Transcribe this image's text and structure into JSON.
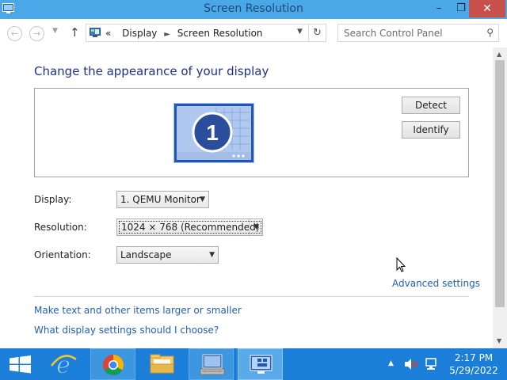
{
  "window": {
    "title": "Screen Resolution",
    "controls": {
      "minimize": "–",
      "maximize": "❐",
      "close": "✕"
    }
  },
  "address_bar": {
    "breadcrumbs": [
      {
        "label": "«"
      },
      {
        "label": "Display"
      },
      {
        "label": "Screen Resolution"
      }
    ],
    "search_placeholder": "Search Control Panel"
  },
  "content": {
    "heading": "Change the appearance of your display",
    "monitor": {
      "number": "1"
    },
    "buttons": {
      "detect": "Detect",
      "identify": "Identify"
    },
    "fields": {
      "display": {
        "label": "Display:",
        "value": "1. QEMU Monitor"
      },
      "resolution": {
        "label": "Resolution:",
        "value": "1024 × 768 (Recommended)"
      },
      "orientation": {
        "label": "Orientation:",
        "value": "Landscape"
      }
    },
    "advanced_link": "Advanced settings",
    "links": [
      "Make text and other items larger or smaller",
      "What display settings should I choose?"
    ]
  },
  "taskbar": {
    "items": [
      {
        "name": "start",
        "icon": "windows-logo-icon"
      },
      {
        "name": "internet-explorer",
        "icon": "ie-icon"
      },
      {
        "name": "chrome",
        "icon": "chrome-icon"
      },
      {
        "name": "file-explorer",
        "icon": "folder-icon"
      },
      {
        "name": "network",
        "icon": "network-computer-icon"
      },
      {
        "name": "display-settings",
        "icon": "display-settings-icon"
      }
    ],
    "clock": {
      "time": "2:17 PM",
      "date": "5/29/2022"
    }
  },
  "colors": {
    "titlebar": "#4aa7e8",
    "taskbar": "#1b7fd9",
    "link": "#2060b8",
    "heading": "#1e3287",
    "close_button": "#c7504b"
  }
}
